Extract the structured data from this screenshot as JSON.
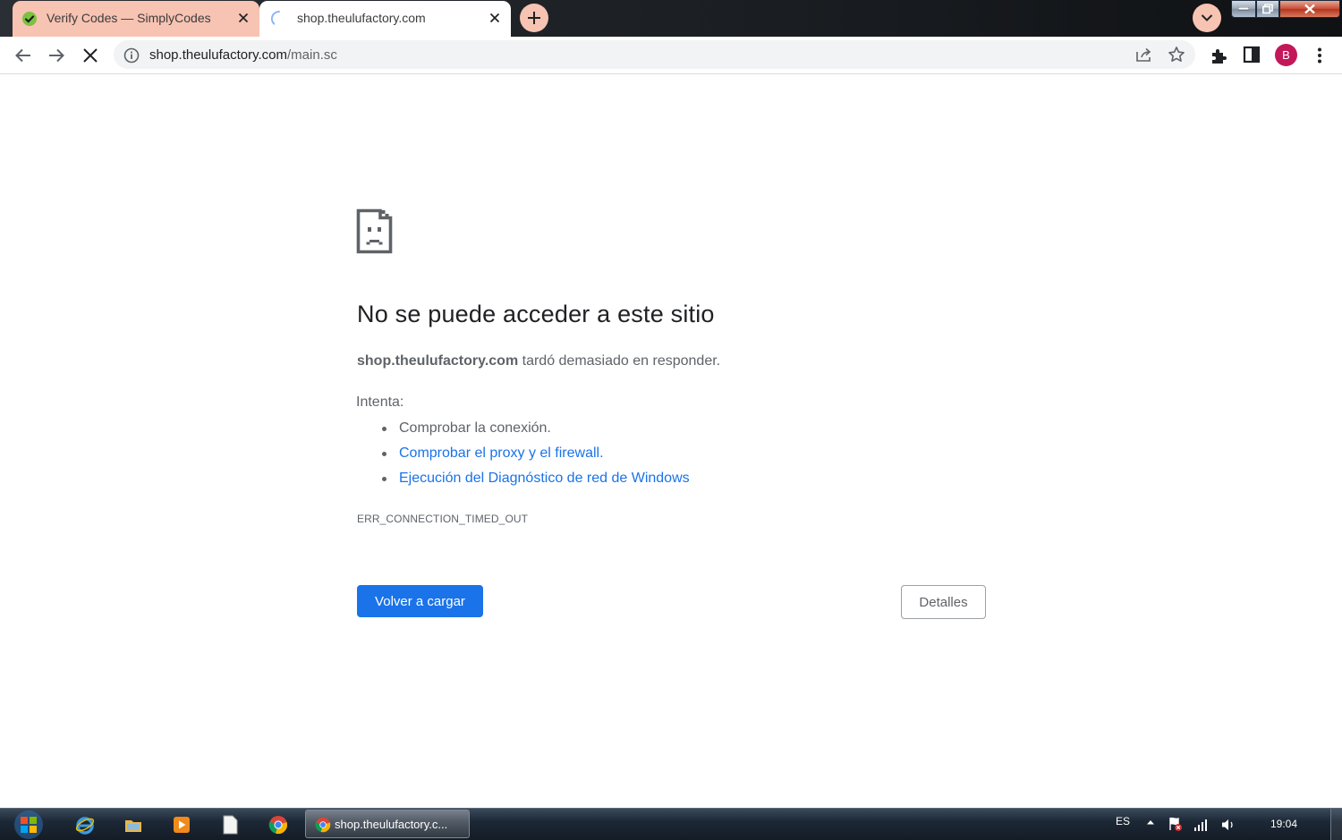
{
  "browser": {
    "tabs": [
      {
        "title": "Verify Codes — SimplyCodes",
        "favicon": "simplycodes-check-icon",
        "active": false
      },
      {
        "title": "shop.theulufactory.com",
        "favicon": "loading-spinner-icon",
        "active": true
      }
    ],
    "accent_color": "#f7c3b2",
    "omnibox": {
      "host": "shop.theulufactory.com",
      "path": "/main.sc"
    },
    "profile_initial": "B",
    "profile_color": "#c2185b"
  },
  "error_page": {
    "heading": "No se puede acceder a este sitio",
    "summary_host": "shop.theulufactory.com",
    "summary_rest": " tardó demasiado en responder.",
    "try_label": "Intenta:",
    "suggestions": [
      {
        "text": "Comprobar la conexión.",
        "link": false
      },
      {
        "text": "Comprobar el proxy y el firewall.",
        "link": true
      },
      {
        "text": "Ejecución del Diagnóstico de red de Windows",
        "link": true
      }
    ],
    "error_code": "ERR_CONNECTION_TIMED_OUT",
    "reload_label": "Volver a cargar",
    "details_label": "Detalles",
    "link_color": "#1a73e8"
  },
  "taskbar": {
    "active_window_label": "shop.theulufactory.c...",
    "language": "ES",
    "clock": "19:04"
  }
}
